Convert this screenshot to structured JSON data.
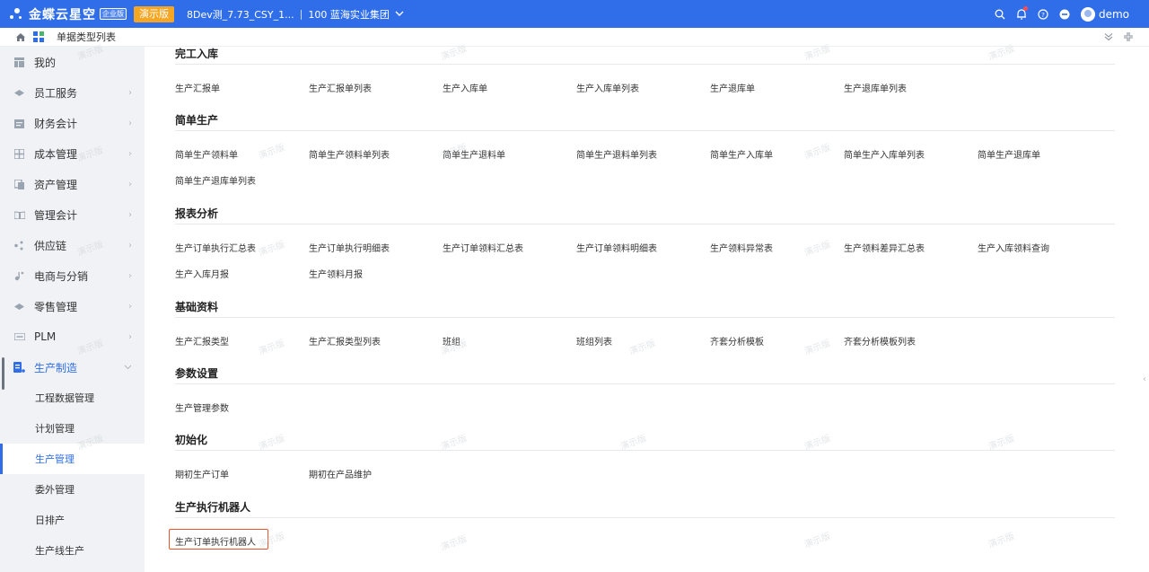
{
  "topbar": {
    "logo_text": "金蝶云星空",
    "logo_badge": "企业版",
    "demo_tag": "演示版",
    "tenant_db": "8Dev测_7.73_CSY_1...",
    "org": "100 蓝海实业集团",
    "user": "demo"
  },
  "breadcrumb": {
    "label": "单据类型列表"
  },
  "sidebar": {
    "items": [
      {
        "label": "我的",
        "icon": "grid-icon"
      },
      {
        "label": "员工服务",
        "icon": "person-icon"
      },
      {
        "label": "财务会计",
        "icon": "ledger-icon"
      },
      {
        "label": "成本管理",
        "icon": "cost-icon"
      },
      {
        "label": "资产管理",
        "icon": "asset-icon"
      },
      {
        "label": "管理会计",
        "icon": "book-icon"
      },
      {
        "label": "供应链",
        "icon": "chain-icon"
      },
      {
        "label": "电商与分销",
        "icon": "cart-icon"
      },
      {
        "label": "零售管理",
        "icon": "store-icon"
      },
      {
        "label": "PLM",
        "icon": "plm-icon"
      },
      {
        "label": "生产制造",
        "icon": "factory-icon"
      }
    ],
    "sub_items": [
      {
        "label": "工程数据管理"
      },
      {
        "label": "计划管理"
      },
      {
        "label": "生产管理"
      },
      {
        "label": "委外管理"
      },
      {
        "label": "日排产"
      },
      {
        "label": "生产线生产"
      }
    ]
  },
  "sections": [
    {
      "title": "完工入库",
      "links": [
        "生产汇报单",
        "生产汇报单列表",
        "生产入库单",
        "生产入库单列表",
        "生产退库单",
        "生产退库单列表"
      ]
    },
    {
      "title": "简单生产",
      "links": [
        "简单生产领料单",
        "简单生产领料单列表",
        "简单生产退料单",
        "简单生产退料单列表",
        "简单生产入库单",
        "简单生产入库单列表",
        "简单生产退库单",
        "简单生产退库单列表"
      ]
    },
    {
      "title": "报表分析",
      "links": [
        "生产订单执行汇总表",
        "生产订单执行明细表",
        "生产订单领料汇总表",
        "生产订单领料明细表",
        "生产领料异常表",
        "生产领料差异汇总表",
        "生产入库领料查询",
        "生产入库月报",
        "生产领料月报"
      ]
    },
    {
      "title": "基础资料",
      "links": [
        "生产汇报类型",
        "生产汇报类型列表",
        "班组",
        "班组列表",
        "齐套分析模板",
        "齐套分析模板列表"
      ]
    },
    {
      "title": "参数设置",
      "links": [
        "生产管理参数"
      ]
    },
    {
      "title": "初始化",
      "links": [
        "期初生产订单",
        "期初在产品维护"
      ]
    },
    {
      "title": "生产执行机器人",
      "links": [
        "生产订单执行机器人"
      ]
    }
  ],
  "watermark_text": "演示版",
  "colors": {
    "primary": "#2f6ee8",
    "demo_tag": "#f5a623",
    "highlight": "#e8552f"
  }
}
